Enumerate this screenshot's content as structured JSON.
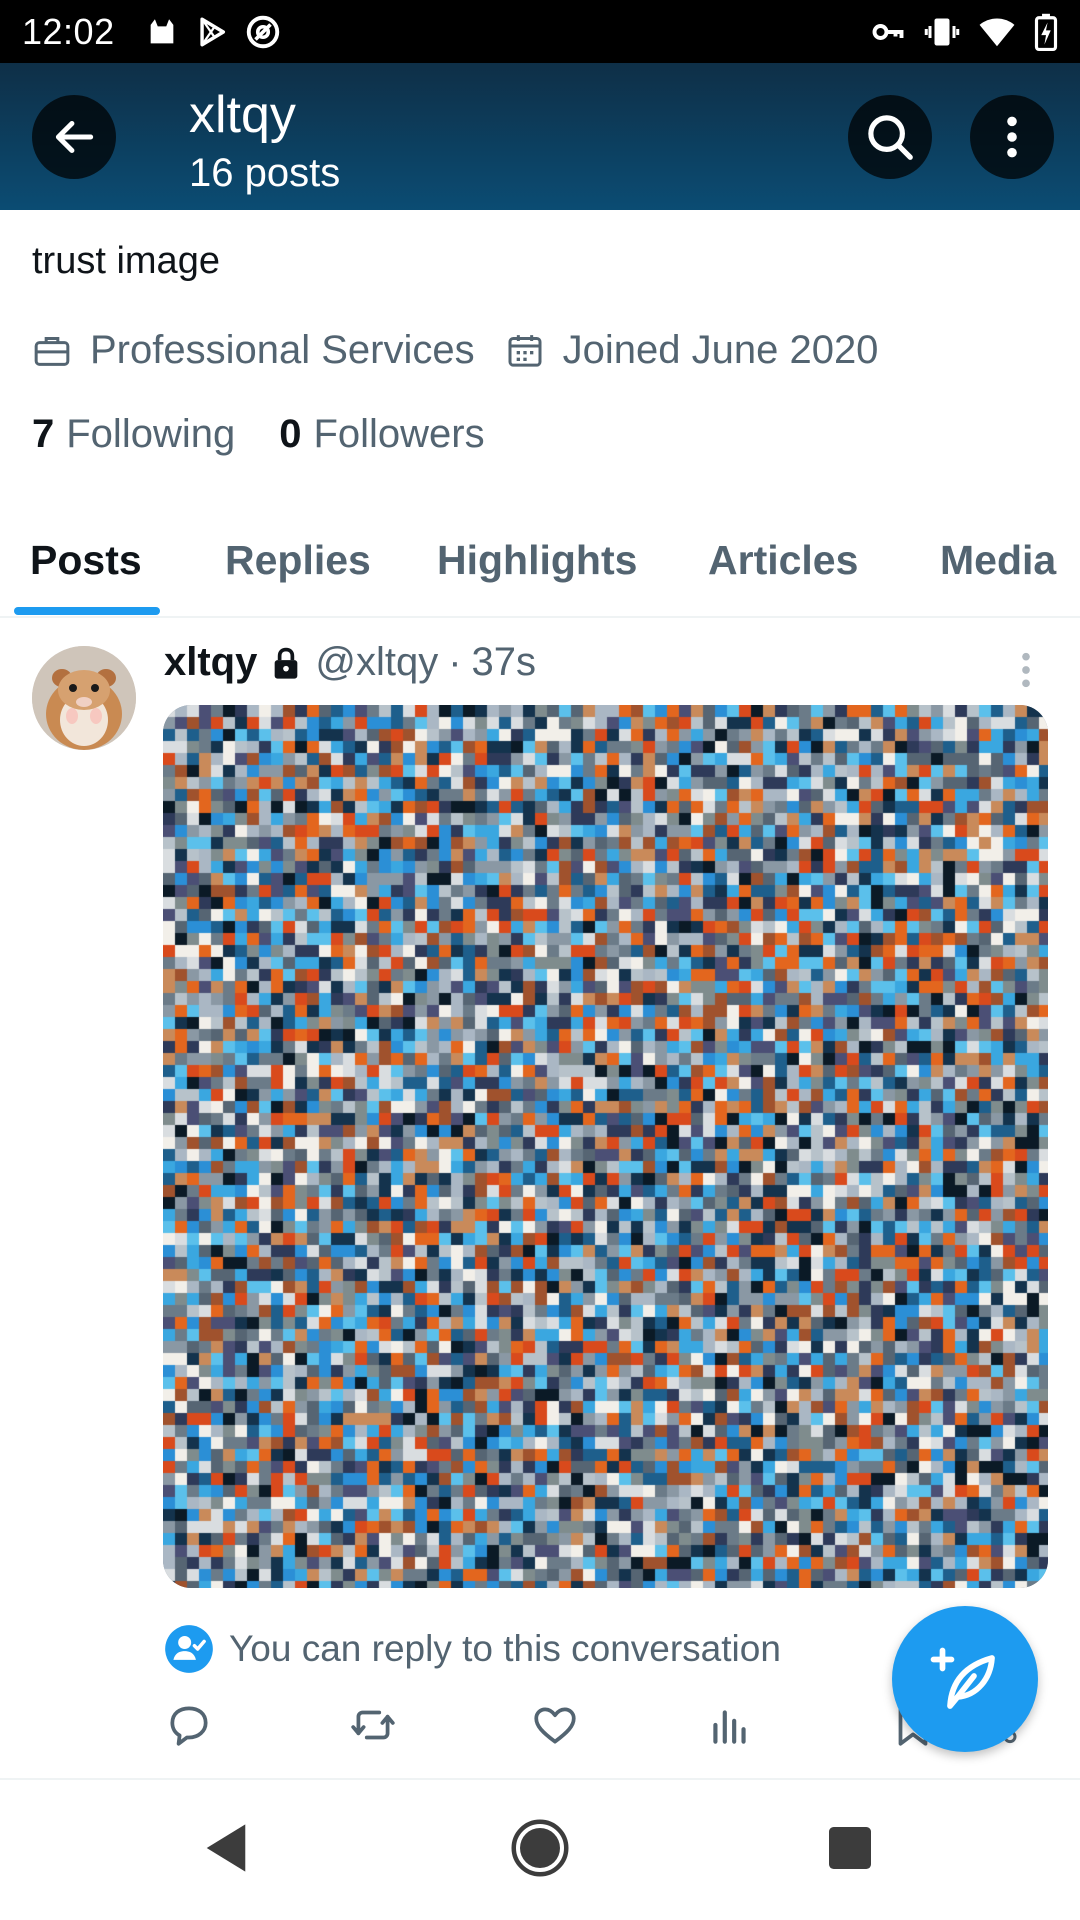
{
  "status_bar": {
    "time": "12:02",
    "left_icons": [
      "cat-icon",
      "play-store-icon",
      "at-sign-icon"
    ],
    "right_icons": [
      "vpn-key-icon",
      "vibrate-icon",
      "wifi-icon",
      "battery-charging-icon"
    ]
  },
  "header": {
    "title": "xltqy",
    "subtitle": "16 posts",
    "icons": [
      "back-arrow-icon",
      "search-icon",
      "more-vert-icon"
    ]
  },
  "profile": {
    "bio": "trust image",
    "category": "Professional Services",
    "joined": "Joined June 2020",
    "following_count": "7",
    "following_label": "Following",
    "followers_count": "0",
    "followers_label": "Followers"
  },
  "tabs": {
    "items": [
      {
        "label": "Posts",
        "active": true
      },
      {
        "label": "Replies",
        "active": false
      },
      {
        "label": "Highlights",
        "active": false
      },
      {
        "label": "Articles",
        "active": false
      },
      {
        "label": "Media",
        "active": false
      }
    ]
  },
  "tweet": {
    "author": "xltqy",
    "handle": "@xltqy",
    "separator": "·",
    "time": "37s",
    "reply_notice": "You can reply to this conversation",
    "actions": [
      "reply-icon",
      "retweet-icon",
      "like-icon",
      "views-icon",
      "bookmark-icon",
      "share-icon"
    ]
  },
  "fab": {
    "icon": "compose-post-icon"
  },
  "nav_bar": {
    "icons": [
      "nav-back-icon",
      "nav-home-icon",
      "nav-recents-icon"
    ]
  },
  "colors": {
    "accent": "#1d9bf0",
    "text_primary": "#0f1419",
    "text_secondary": "#536471",
    "header_top": "#0e2f47",
    "header_bottom": "#0b4c73"
  }
}
